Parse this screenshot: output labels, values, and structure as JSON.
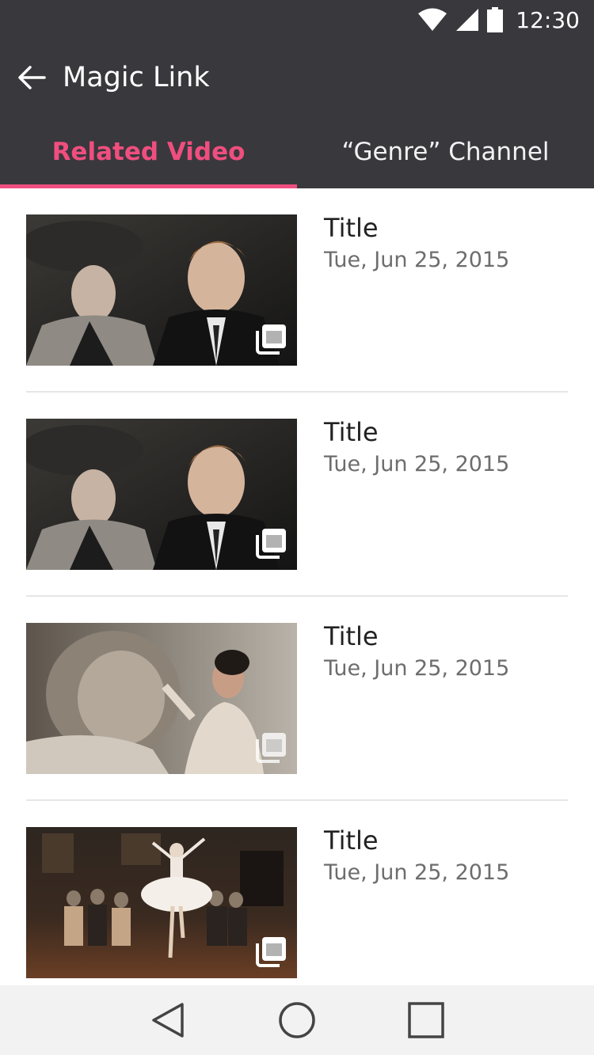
{
  "status_bar": {
    "time": "12:30",
    "icons": [
      "wifi-icon",
      "signal-icon",
      "battery-icon"
    ]
  },
  "app_bar": {
    "back_icon": "arrow-left-icon",
    "title": "Magic Link"
  },
  "tabs": [
    {
      "label": "Related Video",
      "active": true
    },
    {
      "label": "“Genre” Channel",
      "active": false
    }
  ],
  "videos": [
    {
      "title": "Title",
      "date": "Tue, Jun 25, 2015",
      "thumbnail": "period-drama-couple"
    },
    {
      "title": "Title",
      "date": "Tue, Jun 25, 2015",
      "thumbnail": "period-drama-couple"
    },
    {
      "title": "Title",
      "date": "Tue, Jun 25, 2015",
      "thumbnail": "statue-and-woman"
    },
    {
      "title": "Title",
      "date": "Tue, Jun 25, 2015",
      "thumbnail": "ballet-dancer-in-hall"
    }
  ],
  "nav_bar": {
    "icons": [
      "back-triangle-icon",
      "home-circle-icon",
      "recents-square-icon"
    ]
  },
  "colors": {
    "app_bar": "#39383d",
    "accent": "#f04e7f",
    "nav_bar": "#f2f2f2"
  }
}
